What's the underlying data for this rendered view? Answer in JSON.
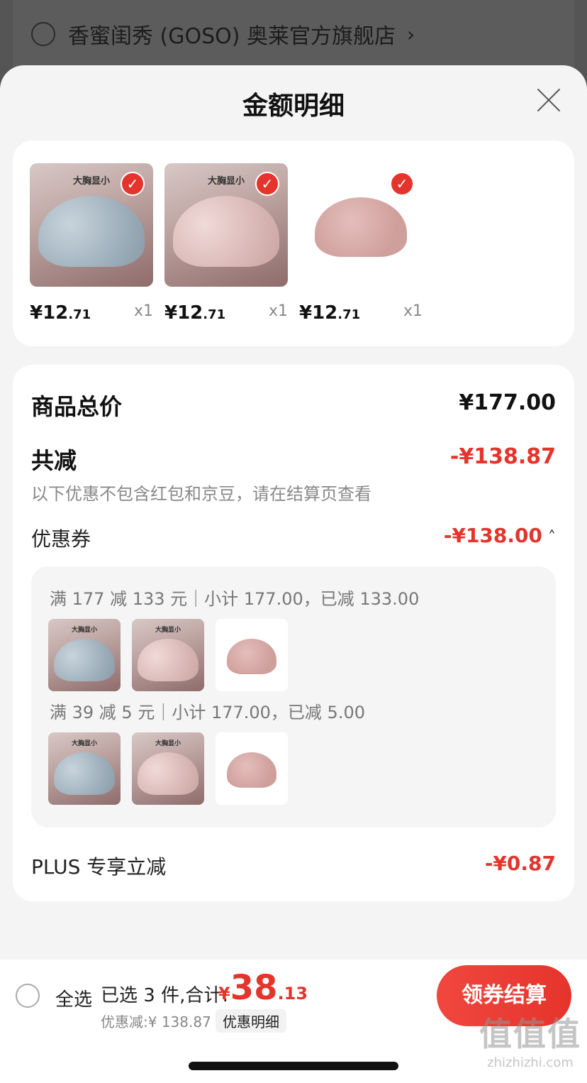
{
  "store": {
    "name": "香蜜闺秀 (GOSO) 奥莱官方旗舰店",
    "chevron": "›"
  },
  "sheet": {
    "title": "金额明细",
    "close_icon": "close-icon"
  },
  "products": [
    {
      "tagline": "大胸显小",
      "price_int": "¥12",
      "price_dec": ".71",
      "qty": "x1",
      "color": "blue",
      "checked": true
    },
    {
      "tagline": "大胸显小",
      "price_int": "¥12",
      "price_dec": ".71",
      "qty": "x1",
      "color": "pink",
      "checked": true
    },
    {
      "tagline": "",
      "price_int": "¥12",
      "price_dec": ".71",
      "qty": "x1",
      "color": "plain",
      "checked": true
    }
  ],
  "summary": {
    "total_label": "商品总价",
    "total_value": "¥177.00",
    "reduce_label": "共减",
    "reduce_value": "-¥138.87",
    "reduce_note": "以下优惠不包含红包和京豆，请在结算页查看",
    "coupon_label": "优惠券",
    "coupon_value": "-¥138.00",
    "coupon_chevron": "˄",
    "coupons": [
      {
        "text": "满 177 减 133 元｜小计 177.00，已减 133.00"
      },
      {
        "text": "满 39 减 5 元｜小计 177.00，已减 5.00"
      }
    ],
    "plus_label": "PLUS 专享立减",
    "plus_value": "-¥0.87"
  },
  "bottom": {
    "select_all": "全选",
    "selected_text": "已选 3 件,合计:",
    "total_yen": "¥",
    "total_int": "38",
    "total_dec": ".13",
    "discount_text": "优惠减:¥ 138.87",
    "detail_link": "优惠明细",
    "checkout": "领券结算"
  },
  "watermark": {
    "big": "值值值",
    "small": "zhizhizhi.com"
  },
  "colors": {
    "accent": "#e5342c",
    "sheet_bg": "#f4f4f4",
    "card_bg": "#ffffff"
  }
}
